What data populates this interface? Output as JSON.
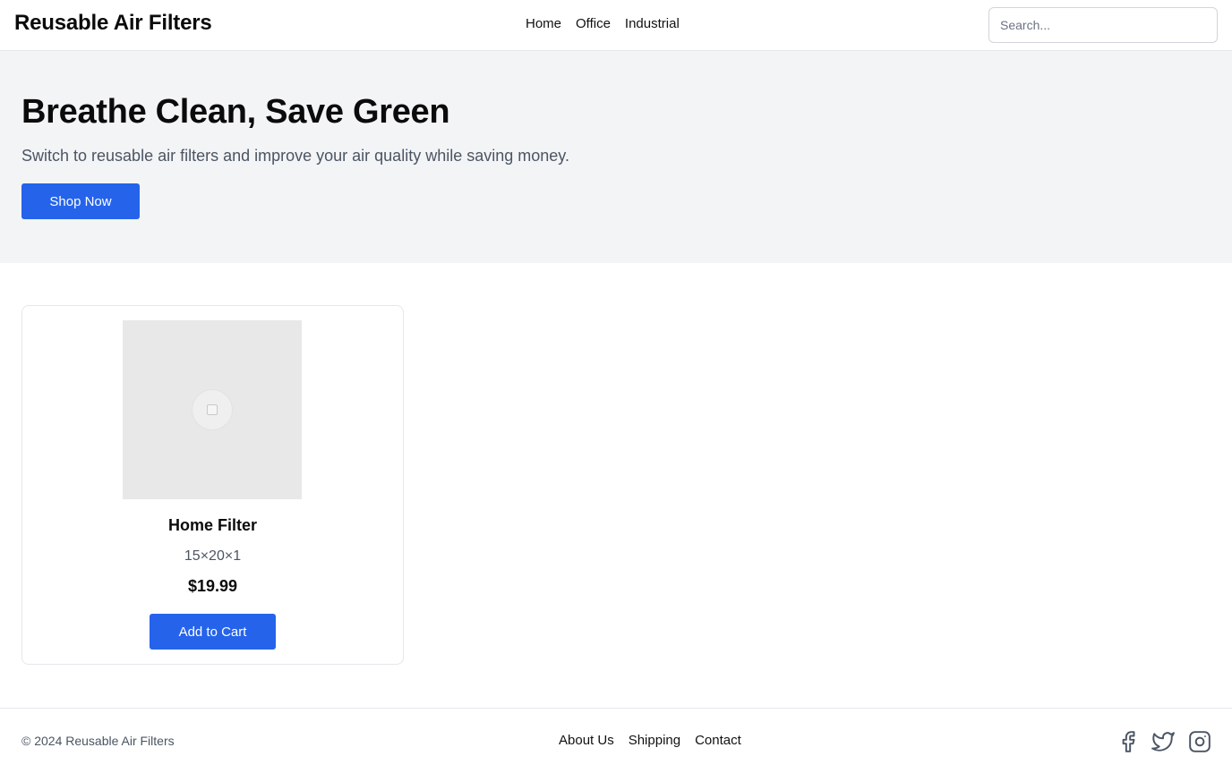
{
  "header": {
    "brand": "Reusable Air Filters",
    "nav": [
      {
        "label": "Home"
      },
      {
        "label": "Office"
      },
      {
        "label": "Industrial"
      }
    ],
    "search_placeholder": "Search..."
  },
  "hero": {
    "title": "Breathe Clean, Save Green",
    "subtitle": "Switch to reusable air filters and improve your air quality while saving money.",
    "cta_label": "Shop Now"
  },
  "products": [
    {
      "name": "Home Filter",
      "size": "15×20×1",
      "price": "$19.99",
      "add_to_cart_label": "Add to Cart",
      "image_icon": "image-placeholder-icon"
    }
  ],
  "footer": {
    "copyright": "© 2024 Reusable Air Filters",
    "links": [
      {
        "label": "About Us"
      },
      {
        "label": "Shipping"
      },
      {
        "label": "Contact"
      }
    ],
    "social": [
      {
        "icon": "facebook-icon"
      },
      {
        "icon": "twitter-icon"
      },
      {
        "icon": "instagram-icon"
      }
    ]
  },
  "colors": {
    "accent": "#2563eb",
    "hero_bg": "#f3f4f6",
    "muted_text": "#4b5563",
    "border": "#e5e7eb"
  }
}
